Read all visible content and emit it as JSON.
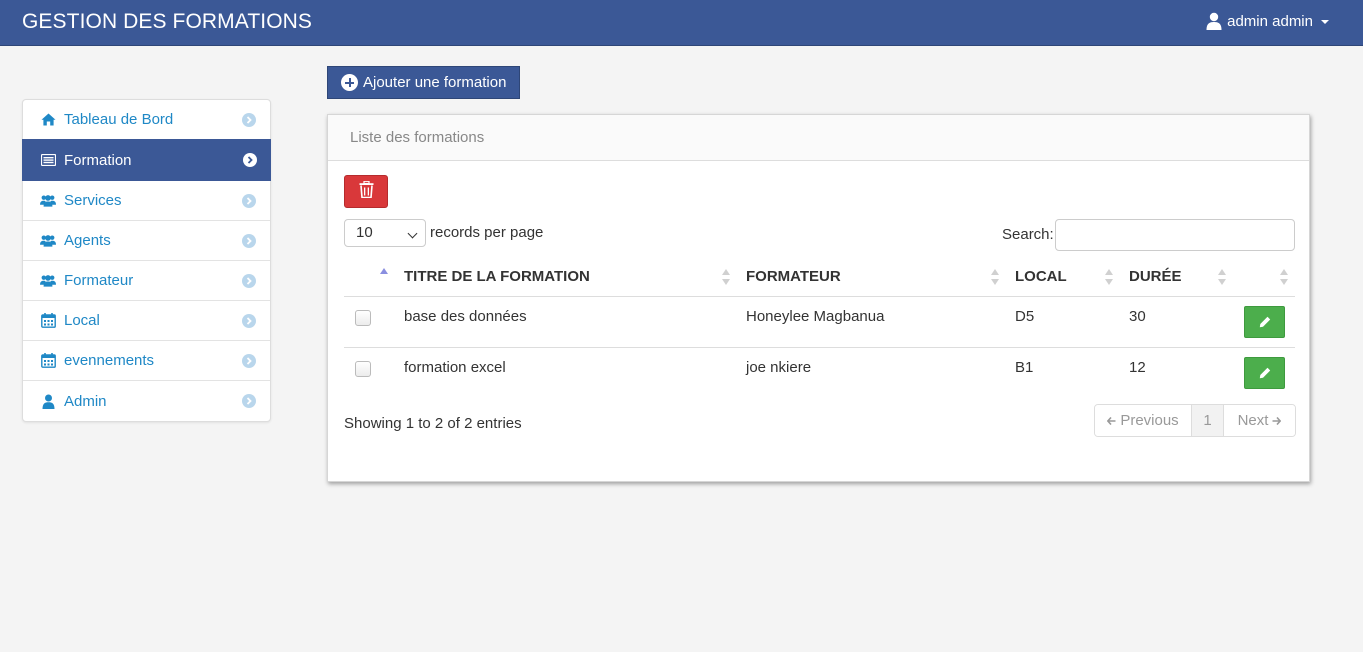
{
  "app": {
    "title": "GESTION DES FORMATIONS",
    "user_label": "admin admin"
  },
  "sidebar": {
    "items": [
      {
        "label": "Tableau de Bord",
        "icon": "home-icon"
      },
      {
        "label": "Formation",
        "icon": "list-icon",
        "active": true
      },
      {
        "label": "Services",
        "icon": "users-icon"
      },
      {
        "label": "Agents",
        "icon": "users-icon"
      },
      {
        "label": "Formateur",
        "icon": "users-icon"
      },
      {
        "label": "Local",
        "icon": "calendar-icon"
      },
      {
        "label": "evennements",
        "icon": "calendar-icon"
      },
      {
        "label": "Admin",
        "icon": "user-icon"
      }
    ]
  },
  "toolbar": {
    "add_label": "Ajouter une formation"
  },
  "panel": {
    "heading": "Liste des formations",
    "length": {
      "value": "10",
      "label": "records per page"
    },
    "search": {
      "label": "Search:",
      "value": ""
    },
    "columns": [
      "TITRE DE LA FORMATION",
      "FORMATEUR",
      "LOCAL",
      "DURÉE"
    ],
    "rows": [
      {
        "titre": "base des données",
        "formateur": "Honeylee Magbanua",
        "local": "D5",
        "duree": "30"
      },
      {
        "titre": "formation excel",
        "formateur": "joe nkiere",
        "local": "B1",
        "duree": "12"
      }
    ],
    "info": "Showing 1 to 2 of 2 entries",
    "pager": {
      "previous": "Previous",
      "page": "1",
      "next": "Next"
    }
  },
  "colors": {
    "primary": "#3b5896",
    "link": "#1f88c6",
    "danger": "#d9383a",
    "success": "#4cae4c"
  }
}
